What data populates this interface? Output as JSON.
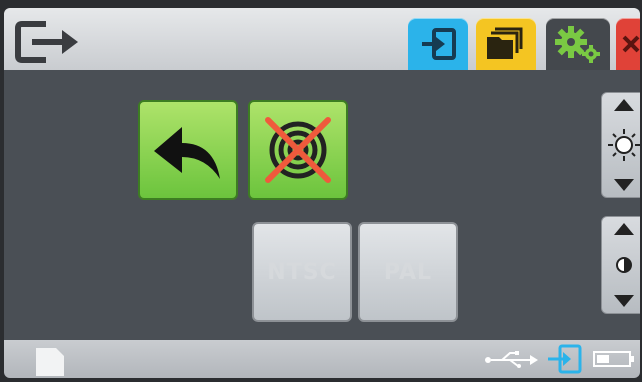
{
  "buttons": {
    "ntsc_label": "NTSC",
    "pal_label": "PAL"
  },
  "icons": {
    "exit": "exit-icon",
    "input": "input-icon",
    "folder": "folder-icon",
    "settings": "gear-icon",
    "close": "close-icon",
    "back": "back-arrow-icon",
    "signal_off": "signal-off-icon",
    "brightness": "sun-icon",
    "contrast": "contrast-icon",
    "usb": "usb-icon",
    "battery": "battery-icon"
  },
  "colors": {
    "tab_input": "#2bb3ea",
    "tab_folder": "#f4c522",
    "tab_settings": "#44484d",
    "tab_close": "#e04238",
    "green_button": "#7fcf45",
    "gray_button": "#cfd3d7",
    "cross": "#ef5a3c"
  }
}
